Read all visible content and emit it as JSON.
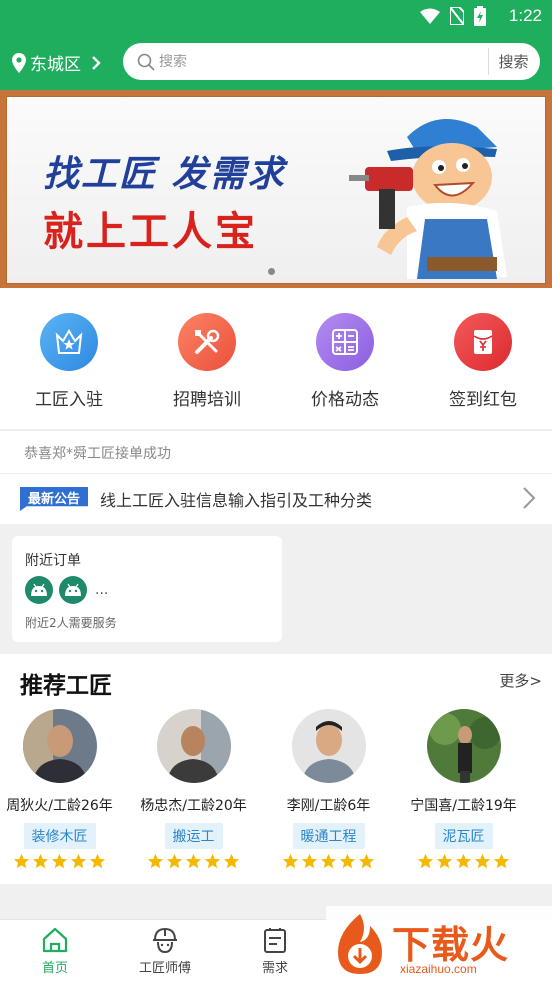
{
  "status_bar": {
    "time": "1:22"
  },
  "header": {
    "location": "东城区",
    "search_placeholder": "搜索",
    "search_button": "搜索"
  },
  "banner": {
    "line1": "找工匠 发需求",
    "line2": "就上工人宝",
    "pages": 1
  },
  "menu": [
    {
      "label": "工匠入驻",
      "icon": "crown-star-icon",
      "color": "#3a9be8"
    },
    {
      "label": "招聘培训",
      "icon": "tools-icon",
      "color": "#f2654a"
    },
    {
      "label": "价格动态",
      "icon": "calculator-icon",
      "color": "#9c6ee6"
    },
    {
      "label": "签到红包",
      "icon": "red-envelope-icon",
      "color": "#e8353a"
    }
  ],
  "ticker": "恭喜郑*舜工匠接单成功",
  "notice": {
    "badge": "最新公告",
    "text": "线上工匠入驻信息输入指引及工种分类"
  },
  "nearby": {
    "title": "附近订单",
    "more": "...",
    "subtitle": "附近2人需要服务"
  },
  "recommend": {
    "title": "推荐工匠",
    "more": "更多>",
    "craftsmen": [
      {
        "name": "周狄火/工龄26年",
        "tag": "装修木匠",
        "rating": 5
      },
      {
        "name": "杨忠杰/工龄20年",
        "tag": "搬运工",
        "rating": 5
      },
      {
        "name": "李刚/工龄6年",
        "tag": "暖通工程",
        "rating": 5
      },
      {
        "name": "宁国喜/工龄19年",
        "tag": "泥瓦匠",
        "rating": 5
      }
    ]
  },
  "tabs": [
    {
      "label": "首页",
      "icon": "home-icon",
      "active": true
    },
    {
      "label": "工匠师傅",
      "icon": "worker-helmet-icon",
      "active": false
    },
    {
      "label": "需求",
      "icon": "clipboard-icon",
      "active": false
    }
  ],
  "watermark": {
    "text": "下载火",
    "sub": "xiazaihuo.com"
  },
  "colors": {
    "primary": "#1fae5d",
    "star": "#f5b800"
  }
}
